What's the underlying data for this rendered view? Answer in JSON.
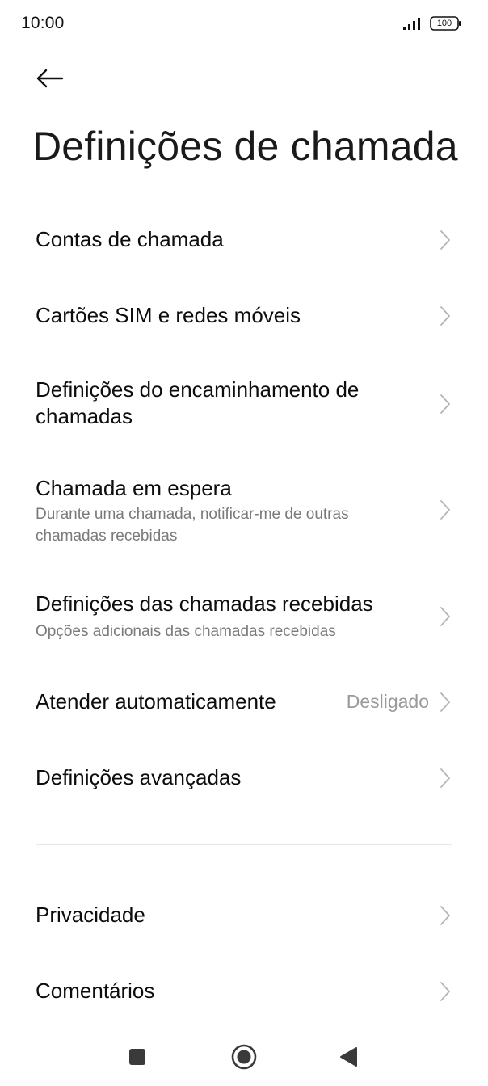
{
  "status_bar": {
    "time": "10:00",
    "battery": "100"
  },
  "header": {
    "title": "Definições de chamada"
  },
  "settings": {
    "contas": {
      "title": "Contas de chamada"
    },
    "sim": {
      "title": "Cartões SIM e redes móveis"
    },
    "encaminhamento": {
      "title": "Definições do encaminhamento de chamadas"
    },
    "espera": {
      "title": "Chamada em espera",
      "subtitle": "Durante uma chamada, notificar-me de outras chamadas recebidas"
    },
    "recebidas": {
      "title": "Definições das chamadas recebidas",
      "subtitle": "Opções adicionais das chamadas recebidas"
    },
    "atender": {
      "title": "Atender automaticamente",
      "value": "Desligado"
    },
    "avancadas": {
      "title": "Definições avançadas"
    },
    "privacidade": {
      "title": "Privacidade"
    },
    "comentarios": {
      "title": "Comentários"
    }
  },
  "icons": {
    "back": "arrow-left-icon",
    "chevron": "chevron-right-icon",
    "recents": "square-icon",
    "home": "circle-icon",
    "back_nav": "triangle-left-icon"
  },
  "colors": {
    "text_primary": "#0d0d0d",
    "text_secondary": "#7a7a7a",
    "chevron": "#b5b5b5",
    "nav_icon": "#3a3a3a"
  }
}
